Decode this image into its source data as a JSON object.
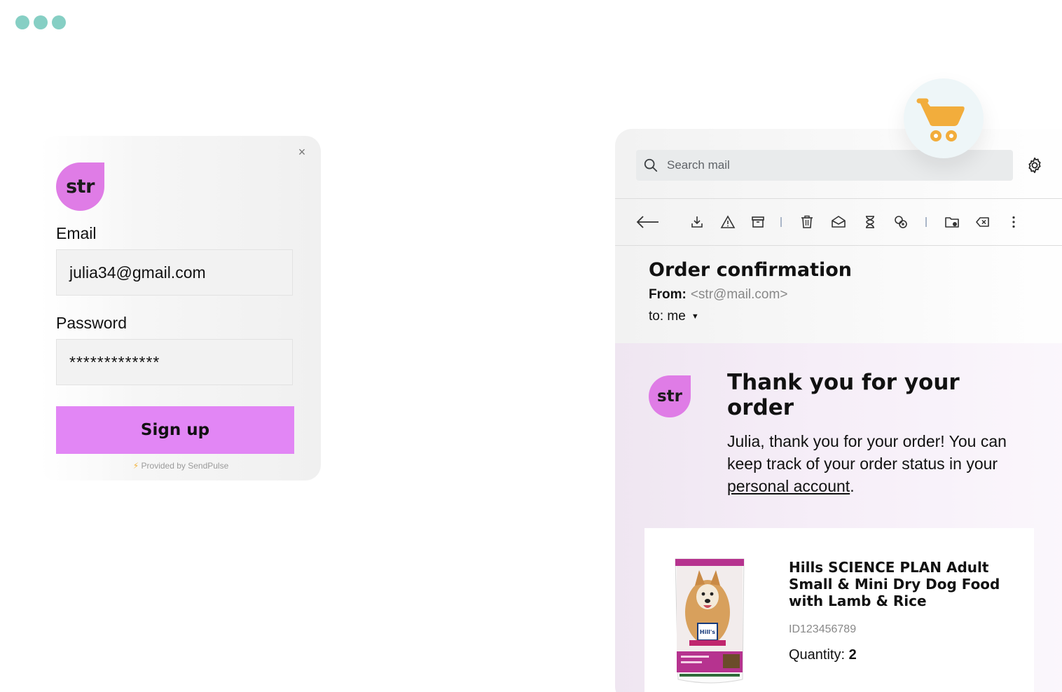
{
  "signup": {
    "logo_text": "str",
    "email_label": "Email",
    "email_value": "julia34@gmail.com",
    "password_label": "Password",
    "password_value": "*************",
    "button_label": "Sign up",
    "provided_text": "Provided by SendPulse",
    "close_glyph": "×"
  },
  "mail": {
    "search_placeholder": "Search mail",
    "toolbar_icons": [
      "back-arrow-icon",
      "download-icon",
      "report-spam-icon",
      "archive-icon",
      "delete-icon",
      "mark-read-icon",
      "snooze-icon",
      "add-task-icon",
      "move-to-icon",
      "label-icon",
      "more-icon"
    ],
    "subject": "Order confirmation",
    "from_label": "From:",
    "from_address": "<str@mail.com>",
    "to_text": "to: me",
    "body": {
      "logo_text": "str",
      "heading": "Thank you for your order",
      "text_before_link": "Julia, thank you for your order! You can keep track of your order status  in your ",
      "link_text": "personal account",
      "text_after_link": "."
    },
    "product": {
      "title": "Hills SCIENCE PLAN Adult Small & Mini Dry Dog Food with Lamb & Rice",
      "id": "ID123456789",
      "quantity_label": "Quantity:",
      "quantity_value": "2"
    }
  },
  "colors": {
    "brand_purple": "#e286f5",
    "logo_purple": "#df7ce6",
    "cart_orange": "#f2ad3c",
    "dots_teal": "#86cfc4"
  }
}
